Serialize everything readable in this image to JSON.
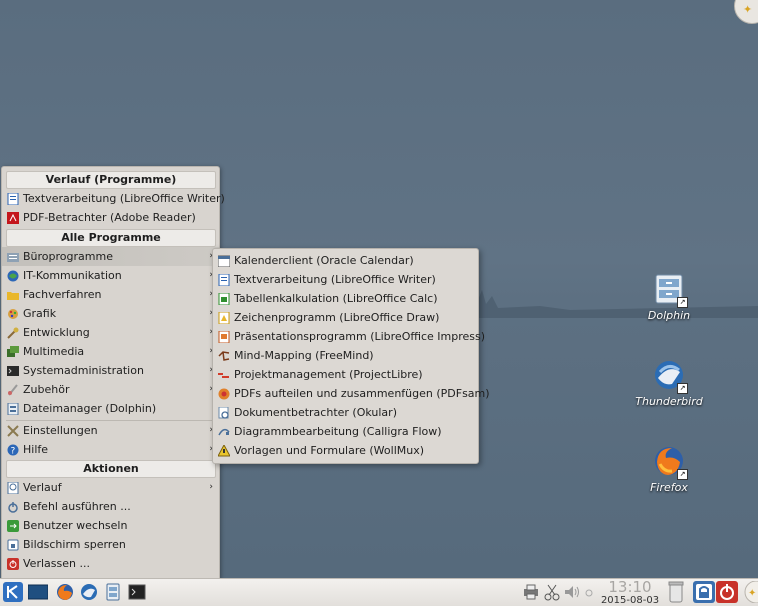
{
  "main_menu": {
    "history_header": "Verlauf (Programme)",
    "history_items": [
      {
        "label": "Textverarbeitung (LibreOffice Writer)",
        "icon": "writer-icon"
      },
      {
        "label": "PDF-Betrachter (Adobe Reader)",
        "icon": "pdf-icon"
      }
    ],
    "all_programs_header": "Alle Programme",
    "programs": [
      {
        "label": "Büroprogramme",
        "icon": "office-icon",
        "submenu": true
      },
      {
        "label": "IT-Kommunikation",
        "icon": "globe-icon",
        "submenu": true
      },
      {
        "label": "Fachverfahren",
        "icon": "folder-icon",
        "submenu": true
      },
      {
        "label": "Grafik",
        "icon": "graphics-icon",
        "submenu": true
      },
      {
        "label": "Entwicklung",
        "icon": "development-icon",
        "submenu": true
      },
      {
        "label": "Multimedia",
        "icon": "multimedia-icon",
        "submenu": true
      },
      {
        "label": "Systemadministration",
        "icon": "terminal-icon",
        "submenu": true
      },
      {
        "label": "Zubehör",
        "icon": "accessories-icon",
        "submenu": true
      },
      {
        "label": "Dateimanager (Dolphin)",
        "icon": "file-manager-icon",
        "submenu": false
      }
    ],
    "extra": [
      {
        "label": "Einstellungen",
        "icon": "settings-icon",
        "submenu": true
      },
      {
        "label": "Hilfe",
        "icon": "help-icon",
        "submenu": true
      }
    ],
    "actions_header": "Aktionen",
    "actions": [
      {
        "label": "Verlauf",
        "icon": "history-icon",
        "submenu": true
      },
      {
        "label": "Befehl ausführen ...",
        "icon": "run-icon",
        "submenu": false
      },
      {
        "label": "Benutzer wechseln",
        "icon": "switch-user-icon",
        "submenu": false
      },
      {
        "label": "Bildschirm sperren",
        "icon": "lock-icon",
        "submenu": false
      },
      {
        "label": "Verlassen ...",
        "icon": "leave-icon",
        "submenu": false
      }
    ]
  },
  "submenu": {
    "items": [
      {
        "label": "Kalenderclient (Oracle Calendar)",
        "icon": "calendar-icon"
      },
      {
        "label": "Textverarbeitung (LibreOffice Writer)",
        "icon": "writer-icon"
      },
      {
        "label": "Tabellenkalkulation (LibreOffice Calc)",
        "icon": "calc-icon"
      },
      {
        "label": "Zeichenprogramm (LibreOffice Draw)",
        "icon": "draw-icon"
      },
      {
        "label": "Präsentationsprogramm (LibreOffice Impress)",
        "icon": "impress-icon"
      },
      {
        "label": "Mind-Mapping (FreeMind)",
        "icon": "mindmap-icon"
      },
      {
        "label": "Projektmanagement (ProjectLibre)",
        "icon": "project-icon"
      },
      {
        "label": "PDFs aufteilen und zusammenfügen (PDFsam)",
        "icon": "pdfsam-icon"
      },
      {
        "label": "Dokumentbetrachter (Okular)",
        "icon": "okular-icon"
      },
      {
        "label": "Diagrammbearbeitung (Calligra Flow)",
        "icon": "flow-icon"
      },
      {
        "label": "Vorlagen und Formulare (WollMux)",
        "icon": "wollmux-icon"
      }
    ]
  },
  "desktop_icons": [
    {
      "label": "Dolphin",
      "icon": "dolphin-icon"
    },
    {
      "label": "Thunderbird",
      "icon": "thunderbird-icon"
    },
    {
      "label": "Firefox",
      "icon": "firefox-icon"
    }
  ],
  "taskbar": {
    "time": "13:10",
    "date": "2015-08-03"
  }
}
